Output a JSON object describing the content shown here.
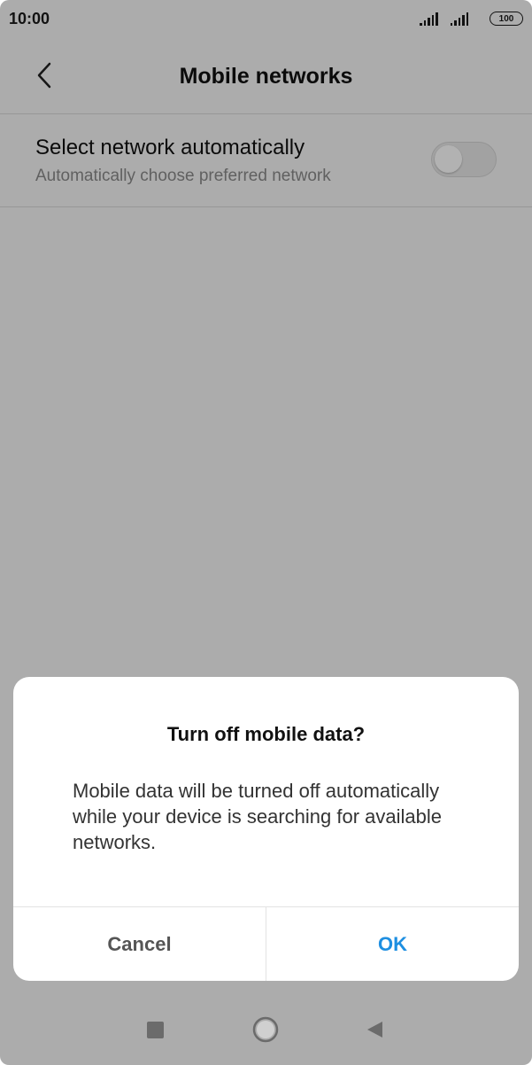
{
  "status_bar": {
    "time": "10:00",
    "battery": "100"
  },
  "header": {
    "back_icon": "chevron-left-icon",
    "title": "Mobile networks"
  },
  "setting": {
    "title": "Select network automatically",
    "subtitle": "Automatically choose preferred network",
    "toggle_on": false
  },
  "dialog": {
    "title": "Turn off mobile data?",
    "message": "Mobile data will be turned off automatically while your device is searching for available networks.",
    "cancel_label": "Cancel",
    "ok_label": "OK",
    "ok_color": "#1e8fe1"
  },
  "nav_bar": {
    "icons": [
      "square-recents-icon",
      "circle-home-icon",
      "triangle-back-icon"
    ]
  }
}
